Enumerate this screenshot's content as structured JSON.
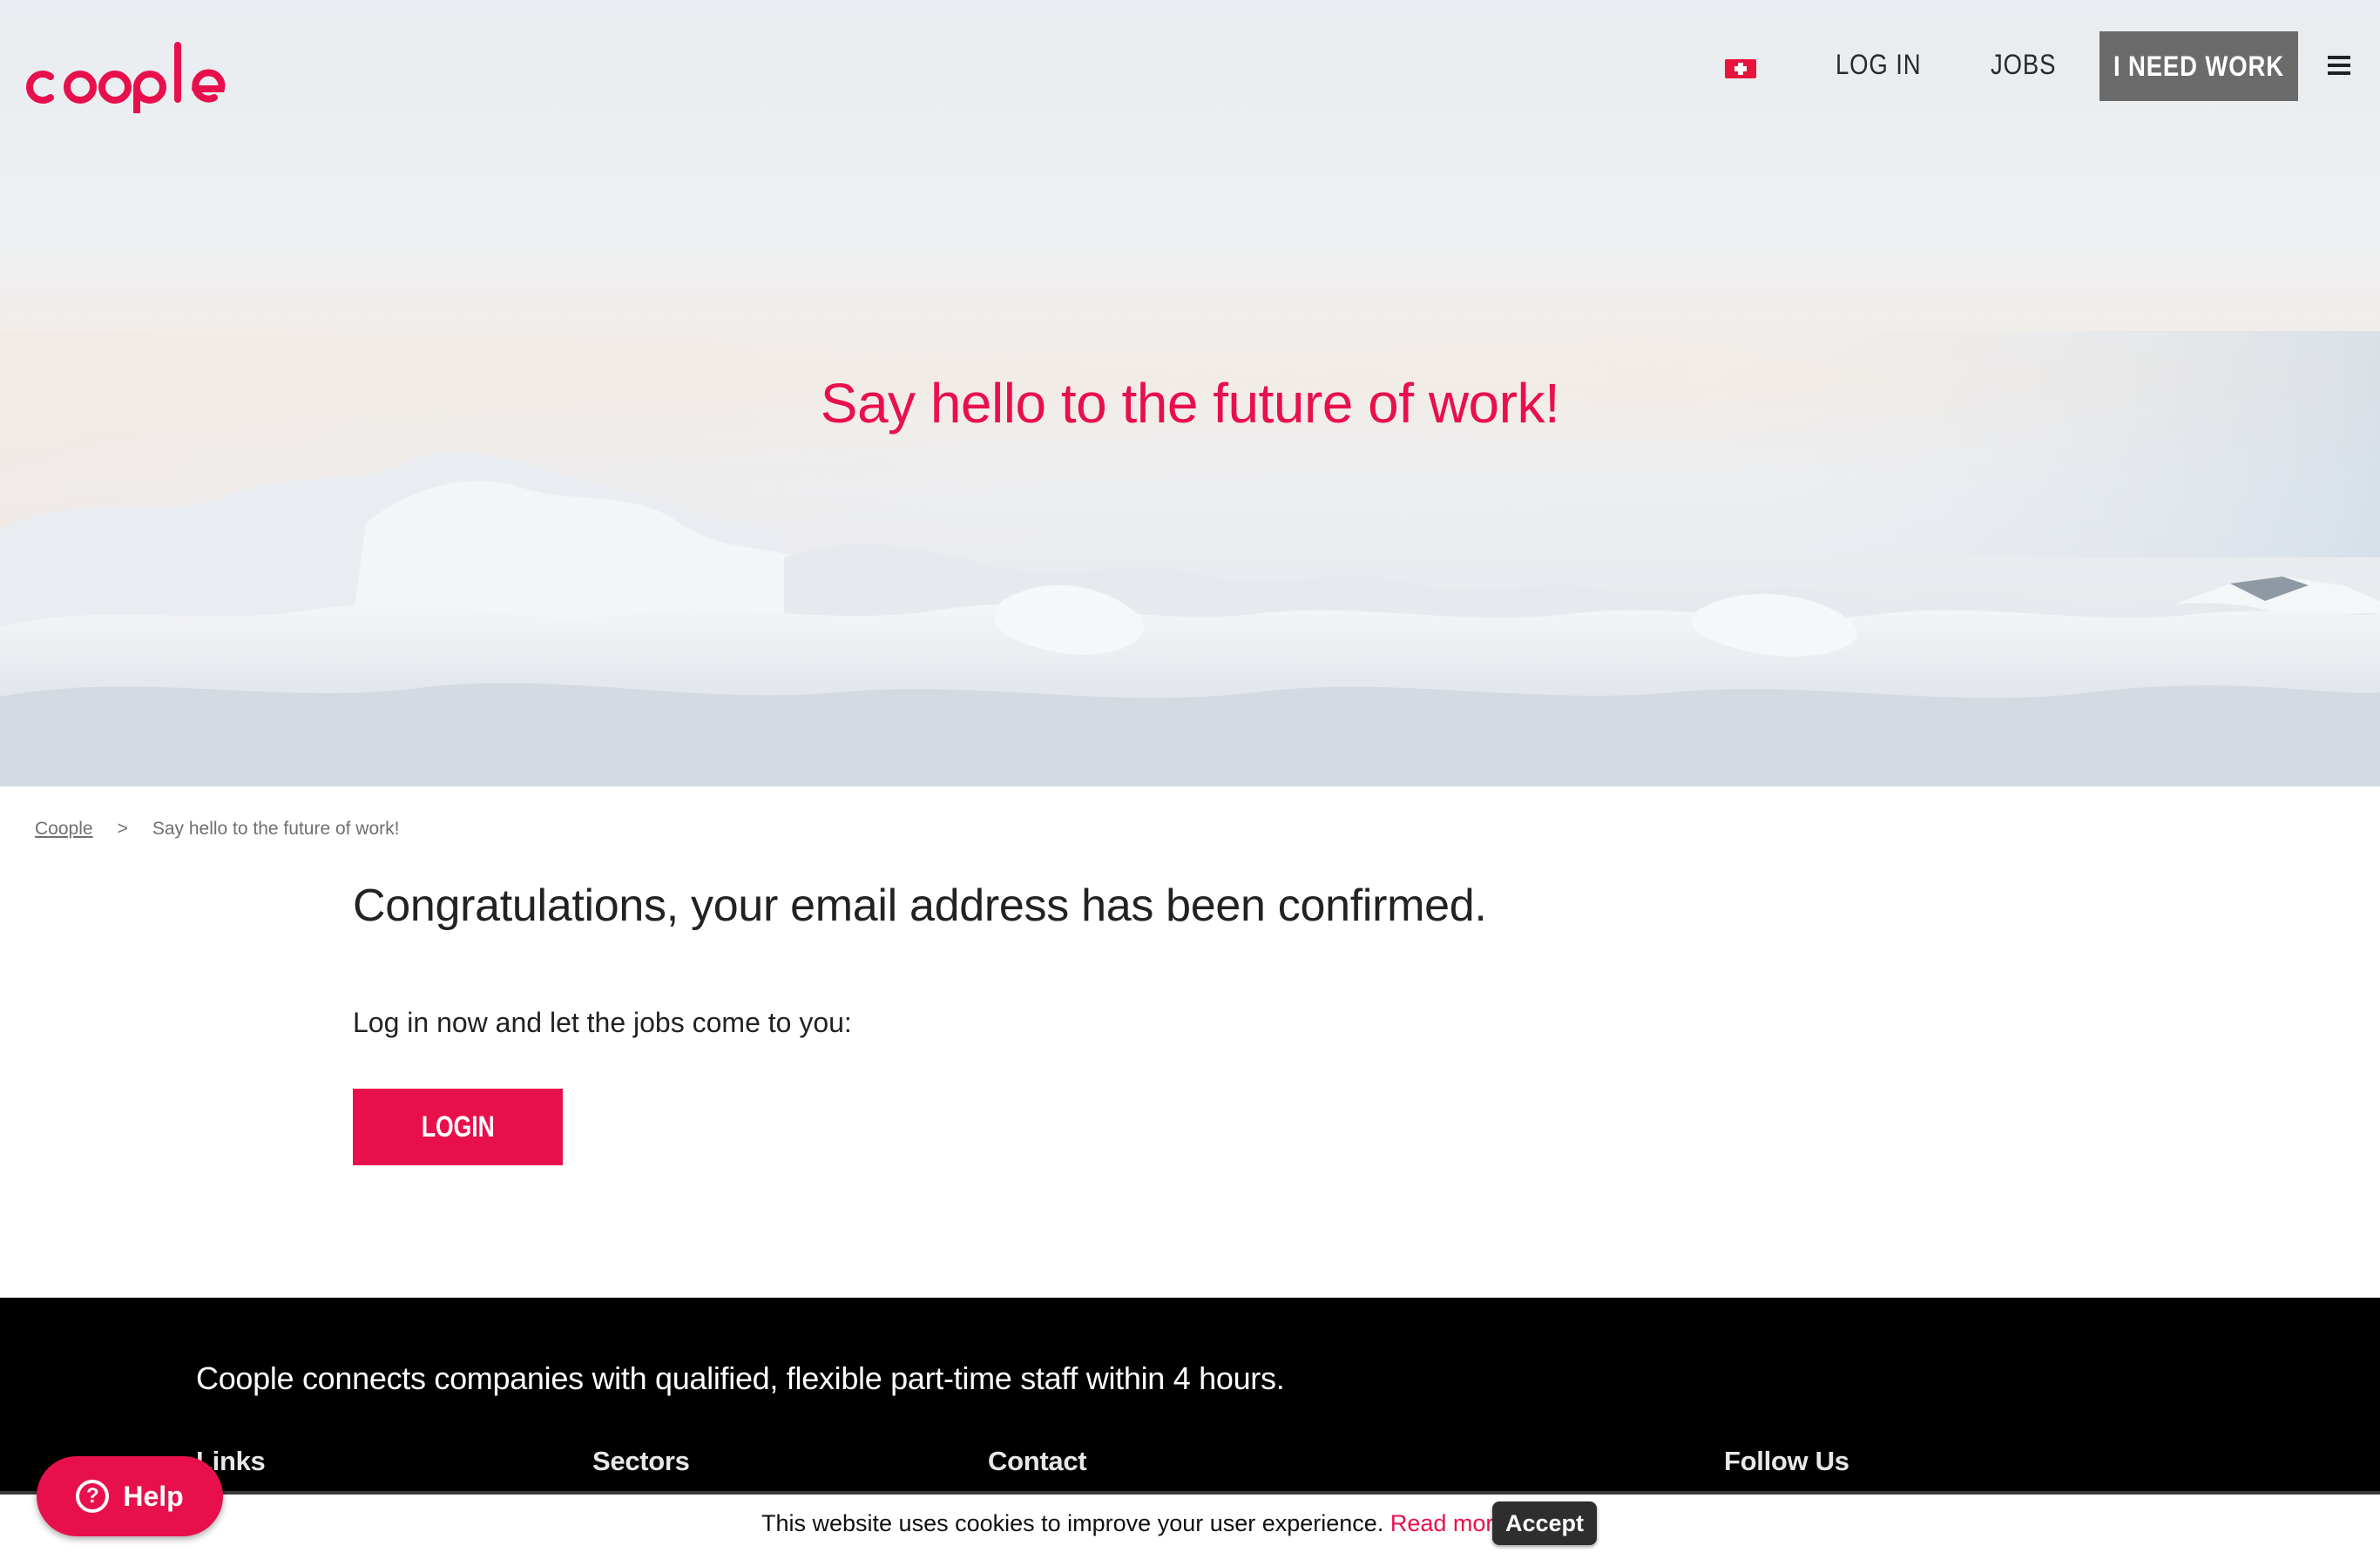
{
  "brand": {
    "logo_text": "coople",
    "accent_color": "#e8104c"
  },
  "nav": {
    "flag_icon": "swiss-flag-icon",
    "login_label": "LOG IN",
    "jobs_label": "JOBS",
    "cta_label": "I NEED WORK",
    "menu_icon": "hamburger-menu-icon"
  },
  "hero": {
    "title": "Say hello to the future of work!"
  },
  "breadcrumb": {
    "home": "Coople",
    "separator": ">",
    "current": "Say hello to the future of work!"
  },
  "main": {
    "heading": "Congratulations, your email address has been confirmed.",
    "instruction": "Log in now and let the jobs come to you:",
    "login_button": "LOGIN"
  },
  "footer": {
    "tagline": "Coople connects companies with qualified, flexible part-time staff within 4 hours.",
    "columns": [
      "Links",
      "Sectors",
      "Contact",
      "Follow Us"
    ]
  },
  "cookie_banner": {
    "message": "This website uses cookies to improve your user experience.",
    "link": "Read more",
    "accept": "Accept"
  },
  "help_widget": {
    "label": "Help",
    "icon": "question-circle-icon"
  }
}
